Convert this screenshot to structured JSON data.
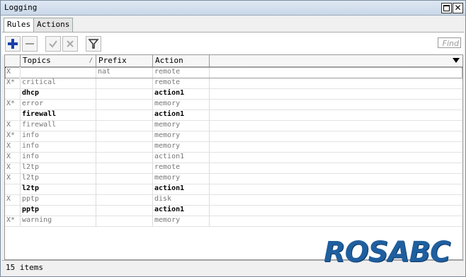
{
  "window": {
    "title": "Logging"
  },
  "tabs": [
    {
      "label": "Rules"
    },
    {
      "label": "Actions"
    }
  ],
  "toolbar": {
    "find_placeholder": "Find"
  },
  "columns": [
    {
      "label": ""
    },
    {
      "label": "Topics"
    },
    {
      "label": "Prefix"
    },
    {
      "label": "Action"
    }
  ],
  "rows": [
    {
      "flag": "X",
      "topics": "",
      "prefix": "nat",
      "action": "remote",
      "disabled": true,
      "selected": true
    },
    {
      "flag": "X*",
      "topics": "critical",
      "prefix": "",
      "action": "remote",
      "disabled": true
    },
    {
      "flag": "",
      "topics": "dhcp",
      "prefix": "",
      "action": "action1",
      "disabled": false
    },
    {
      "flag": "X*",
      "topics": "error",
      "prefix": "",
      "action": "memory",
      "disabled": true
    },
    {
      "flag": "",
      "topics": "firewall",
      "prefix": "",
      "action": "action1",
      "disabled": false
    },
    {
      "flag": "X",
      "topics": "firewall",
      "prefix": "",
      "action": "memory",
      "disabled": true
    },
    {
      "flag": "X*",
      "topics": "info",
      "prefix": "",
      "action": "memory",
      "disabled": true
    },
    {
      "flag": "X",
      "topics": "info",
      "prefix": "",
      "action": "memory",
      "disabled": true
    },
    {
      "flag": "X",
      "topics": "info",
      "prefix": "",
      "action": "action1",
      "disabled": true
    },
    {
      "flag": "X",
      "topics": "l2tp",
      "prefix": "",
      "action": "remote",
      "disabled": true
    },
    {
      "flag": "X",
      "topics": "l2tp",
      "prefix": "",
      "action": "memory",
      "disabled": true
    },
    {
      "flag": "",
      "topics": "l2tp",
      "prefix": "",
      "action": "action1",
      "disabled": false
    },
    {
      "flag": "X",
      "topics": "pptp",
      "prefix": "",
      "action": "disk",
      "disabled": true
    },
    {
      "flag": "",
      "topics": "pptp",
      "prefix": "",
      "action": "action1",
      "disabled": false
    },
    {
      "flag": "X*",
      "topics": "warning",
      "prefix": "",
      "action": "memory",
      "disabled": true
    }
  ],
  "status": {
    "text": "15 items"
  },
  "watermark": {
    "text": "ROSABC"
  }
}
